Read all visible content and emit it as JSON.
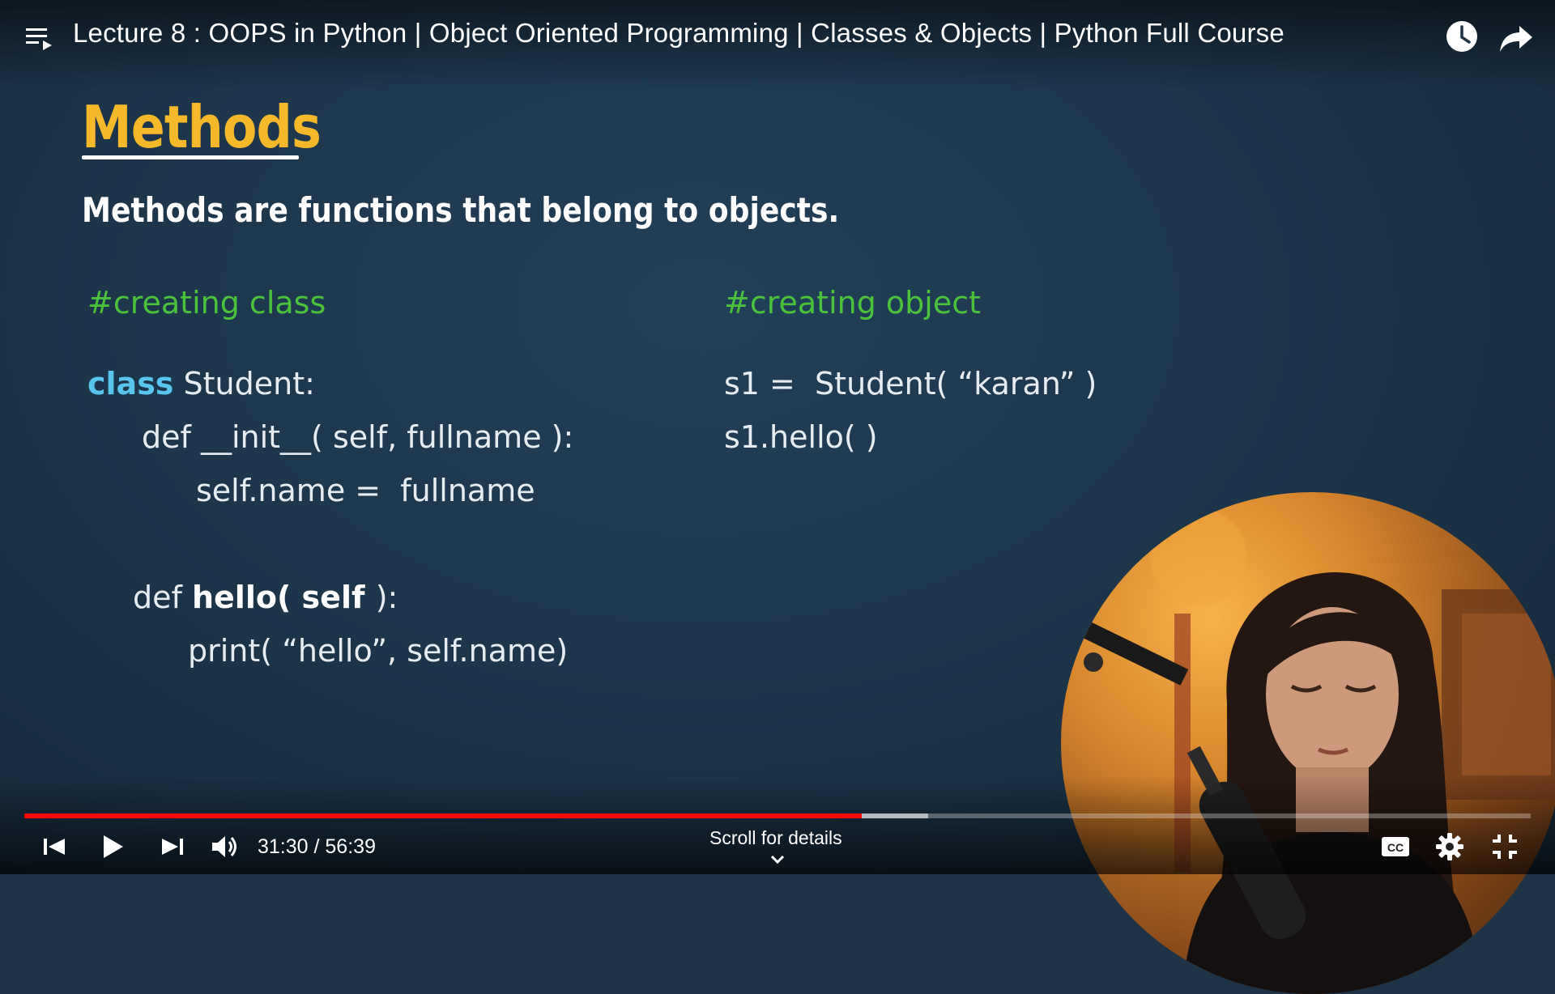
{
  "header": {
    "title": "Lecture 8 : OOPS in Python | Object Oriented Programming | Classes & Objects | Python Full Course",
    "icons": [
      "playlist-icon",
      "watch-later-icon",
      "share-icon"
    ]
  },
  "slide": {
    "heading": "Methods",
    "subtitle": "Methods are functions that belong to objects.",
    "left_code": {
      "comment": "#creating class",
      "class_keyword": "class",
      "class_name": " Student:",
      "init_line": "def __init__( self, fullname ):",
      "assign_line": "self.name =  fullname",
      "hello_def": "def ",
      "hello_name": "hello( self ",
      "hello_end": "):",
      "print_line": "print( “hello”, self.name)"
    },
    "right_code": {
      "comment": "#creating object",
      "create_line": "s1 =  Student( “karan” )",
      "call_line": "s1.hello( )"
    },
    "colors": {
      "heading": "#f5b82a",
      "comment": "#4cc23a",
      "keyword": "#58c6ec",
      "background": "#1f3346"
    }
  },
  "player": {
    "progress_played": 0.556,
    "progress_buffered": 0.6,
    "time_current": "31:30",
    "time_separator": " / ",
    "time_total": "56:39",
    "scroll_hint": "Scroll for details",
    "accent_color": "#ff0000",
    "icons": [
      "previous-icon",
      "play-icon",
      "next-icon",
      "volume-icon",
      "captions-icon",
      "settings-icon",
      "exit-fullscreen-icon",
      "chevron-down-icon"
    ]
  }
}
